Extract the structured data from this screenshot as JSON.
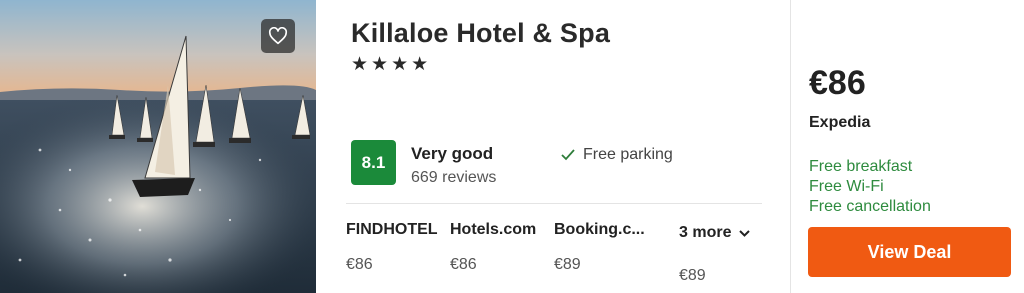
{
  "hotel": {
    "name": "Killaloe Hotel & Spa",
    "stars": "★★★★"
  },
  "rating": {
    "score": "8.1",
    "label": "Very good",
    "reviews": "669 reviews"
  },
  "amenity": {
    "label": "Free parking",
    "icon": "check-icon"
  },
  "providers": [
    {
      "name": "FINDHOTEL",
      "price": "€86"
    },
    {
      "name": "Hotels.com",
      "price": "€86"
    },
    {
      "name": "Booking.c...",
      "price": "€89"
    }
  ],
  "more": {
    "label": "3 more",
    "price": "€89"
  },
  "deal": {
    "price": "€86",
    "provider": "Expedia",
    "perks": [
      "Free breakfast",
      "Free Wi-Fi",
      "Free cancellation"
    ],
    "button_label": "View Deal"
  },
  "colors": {
    "score_badge": "#1b8a3a",
    "perk_text": "#2e8b3e",
    "view_deal": "#f05a12"
  },
  "icons": {
    "favorite": "heart-icon",
    "more": "chevron-down-icon"
  }
}
